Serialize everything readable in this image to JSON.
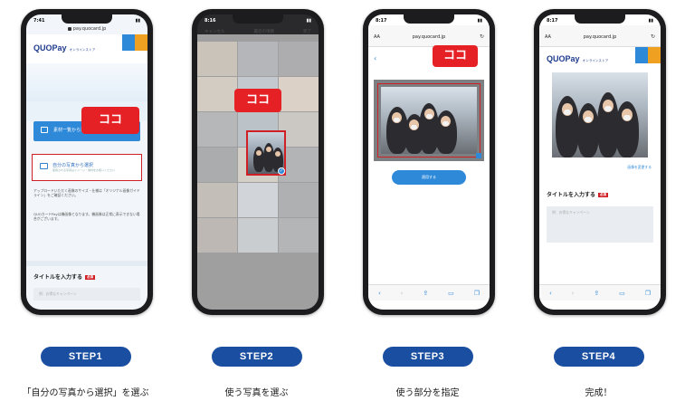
{
  "steps": [
    {
      "label": "STEP1",
      "caption": "「自分の写真から選択」を選ぶ"
    },
    {
      "label": "STEP2",
      "caption": "使う写真を選ぶ"
    },
    {
      "label": "STEP3",
      "caption": "使う部分を指定"
    },
    {
      "label": "STEP4",
      "caption": "完成！"
    }
  ],
  "callout_text": "ココ",
  "phone1": {
    "time": "7:41",
    "url": "pay.quocard.jp",
    "logo": "QUOPay",
    "logo_sub": "オンラインストア",
    "option_blue": "素材一覧から選択",
    "option_white": "自分の写真から選択",
    "option_white_sub": "使用される写真はイメージ・素材をお使いください",
    "note1": "アップロードいただく画像のサイズ・仕様は「オリジナル画像ガイドライン」をご確認ください。",
    "note2": "QUOカードPayは機画像となります。機画像は正常に表示できない場合がございます。",
    "title_label": "タイトルを入力する",
    "required": "必須",
    "input_placeholder": "例：お得なキャンペーン"
  },
  "phone2": {
    "time": "8:16",
    "picker_title": "最近の項目",
    "cancel": "キャンセル",
    "done": "完了"
  },
  "phone3": {
    "time": "8:17",
    "aa": "AA",
    "url": "pay.quocard.jp",
    "apply": "適用する"
  },
  "phone4": {
    "time": "8:17",
    "aa": "AA",
    "url": "pay.quocard.jp",
    "logo": "QUOPay",
    "logo_sub": "オンラインストア",
    "change_link": "画像を変更する",
    "title_label": "タイトルを入力する",
    "required": "必須",
    "input_placeholder": "例：お得なキャンペーン"
  },
  "colors": {
    "step_pill": "#1a4ea0",
    "callout": "#e52126",
    "accent_blue": "#2f89d9"
  }
}
